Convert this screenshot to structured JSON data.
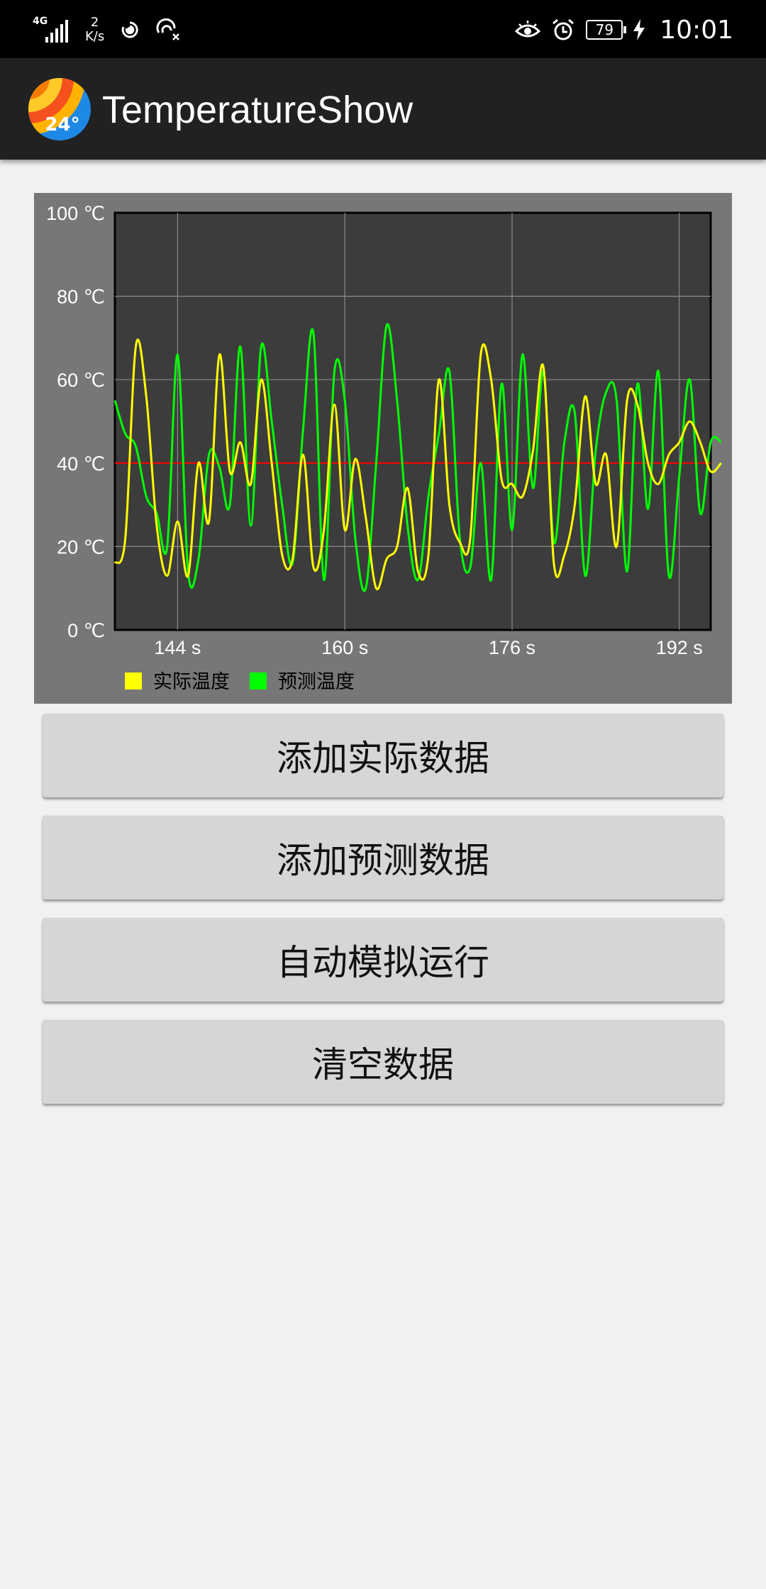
{
  "status_bar": {
    "network": "4G",
    "speed_value": "2",
    "speed_unit": "K/s",
    "battery": "79",
    "time": "10:01",
    "icons": [
      "signal-icon",
      "hotspot-icon",
      "nfc-off-icon",
      "eye-comfort-icon",
      "alarm-icon",
      "battery-icon",
      "charging-icon"
    ]
  },
  "app_bar": {
    "title": "TemperatureShow",
    "logo_text": "24°"
  },
  "chart_data": {
    "type": "line",
    "x": [
      138,
      139,
      140,
      141,
      142,
      143,
      144,
      145,
      146,
      147,
      148,
      149,
      150,
      151,
      152,
      153,
      154,
      155,
      156,
      157,
      158,
      159,
      160,
      161,
      162,
      163,
      164,
      165,
      166,
      167,
      168,
      169,
      170,
      171,
      172,
      173,
      174,
      175,
      176,
      177,
      178,
      179,
      180,
      181,
      182,
      183,
      184,
      185,
      186,
      187,
      188,
      189,
      190,
      191,
      192,
      193,
      194,
      195,
      196
    ],
    "series": [
      {
        "name": "实际温度",
        "color": "#ffff00",
        "values": [
          16,
          22,
          68,
          56,
          25,
          13,
          26,
          13,
          40,
          26,
          66,
          38,
          45,
          35,
          60,
          40,
          18,
          17,
          42,
          15,
          24,
          54,
          24,
          41,
          27,
          10,
          17,
          20,
          34,
          14,
          18,
          60,
          30,
          21,
          22,
          66,
          60,
          36,
          35,
          32,
          43,
          63,
          16,
          18,
          30,
          56,
          35,
          42,
          20,
          55,
          54,
          40,
          35,
          42,
          45,
          50,
          45,
          38,
          40
        ]
      },
      {
        "name": "预测温度",
        "color": "#00ff00",
        "values": [
          55,
          47,
          44,
          32,
          28,
          20,
          66,
          14,
          17,
          42,
          39,
          30,
          68,
          25,
          68,
          50,
          30,
          16,
          48,
          71,
          12,
          62,
          55,
          22,
          10,
          40,
          73,
          55,
          25,
          12,
          32,
          47,
          62,
          22,
          15,
          40,
          12,
          59,
          24,
          66,
          34,
          62,
          21,
          45,
          52,
          13,
          43,
          57,
          55,
          14,
          59,
          29,
          62,
          13,
          37,
          60,
          28,
          45,
          45
        ]
      }
    ],
    "reference_line": {
      "value": 40,
      "color": "#ff0000"
    },
    "xlim": [
      138,
      195
    ],
    "ylim": [
      0,
      100
    ],
    "x_ticks": [
      144,
      160,
      176,
      192
    ],
    "y_ticks": [
      0,
      20,
      40,
      60,
      80,
      100
    ],
    "x_tick_format": "{} s",
    "y_tick_format": "{} ℃",
    "grid": true,
    "legend_position": "bottom-left"
  },
  "buttons": {
    "add_actual": "添加实际数据",
    "add_predicted": "添加预测数据",
    "auto_simulate": "自动模拟运行",
    "clear": "清空数据"
  }
}
